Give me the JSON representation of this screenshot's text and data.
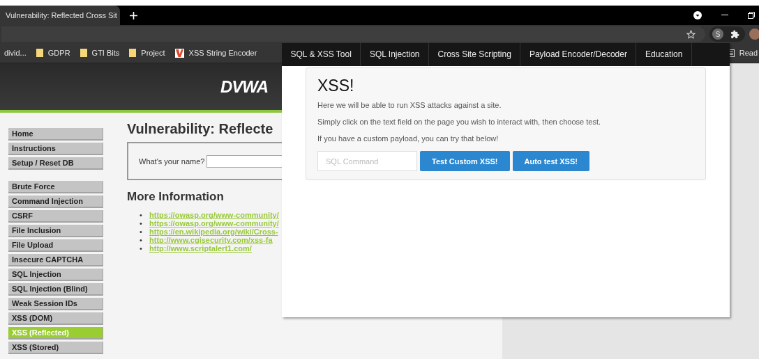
{
  "browser": {
    "tab": {
      "title": "Vulnerability: Reflected Cross Sit",
      "selected": true
    },
    "bookmarks": [
      {
        "label": "divid...",
        "kind": "text"
      },
      {
        "label": "GDPR",
        "kind": "folder"
      },
      {
        "label": "GTI Bits",
        "kind": "folder"
      },
      {
        "label": "Project",
        "kind": "folder"
      },
      {
        "label": "XSS String Encoder",
        "kind": "site"
      }
    ],
    "extension_letter": "S",
    "reading_list": "Read"
  },
  "page": {
    "logo": "DVWA",
    "sidebar": [
      [
        {
          "label": "Home",
          "selected": false
        },
        {
          "label": "Instructions",
          "selected": false
        },
        {
          "label": "Setup / Reset DB",
          "selected": false
        }
      ],
      [
        {
          "label": "Brute Force",
          "selected": false
        },
        {
          "label": "Command Injection",
          "selected": false
        },
        {
          "label": "CSRF",
          "selected": false
        },
        {
          "label": "File Inclusion",
          "selected": false
        },
        {
          "label": "File Upload",
          "selected": false
        },
        {
          "label": "Insecure CAPTCHA",
          "selected": false
        },
        {
          "label": "SQL Injection",
          "selected": false
        },
        {
          "label": "SQL Injection (Blind)",
          "selected": false
        },
        {
          "label": "Weak Session IDs",
          "selected": false
        },
        {
          "label": "XSS (DOM)",
          "selected": false
        },
        {
          "label": "XSS (Reflected)",
          "selected": true
        },
        {
          "label": "XSS (Stored)",
          "selected": false
        }
      ]
    ],
    "heading": "Vulnerability: Reflecte",
    "form_label": "What's your name?",
    "more_heading": "More Information",
    "links": [
      {
        "marker": "•",
        "url": "https://owasp.org/www-community/"
      },
      {
        "marker": "•",
        "url": "https://owasp.org/www-community/"
      },
      {
        "marker": "•",
        "url": "https://en.wikipedia.org/wiki/Cross-"
      },
      {
        "marker": "•",
        "url": "http://www.cgisecurity.com/xss-fa"
      },
      {
        "marker": "•",
        "url": "http://www.scriptalert1.com/"
      }
    ]
  },
  "popup": {
    "nav": [
      {
        "label": "SQL & XSS Tool"
      },
      {
        "label": "SQL Injection"
      },
      {
        "label": "Cross Site Scripting"
      },
      {
        "label": "Payload Encoder/Decoder"
      },
      {
        "label": "Education"
      }
    ],
    "title": "XSS!",
    "paragraphs": [
      "Here we will be able to run XSS attacks against a site.",
      "Simply click on the text field on the page you wish to interact with, then choose test.",
      "If you have a custom payload, you can try that below!"
    ],
    "input": {
      "placeholder": "SQL Command"
    },
    "buttons": [
      "Test Custom XSS!",
      "Auto test XSS!"
    ]
  }
}
